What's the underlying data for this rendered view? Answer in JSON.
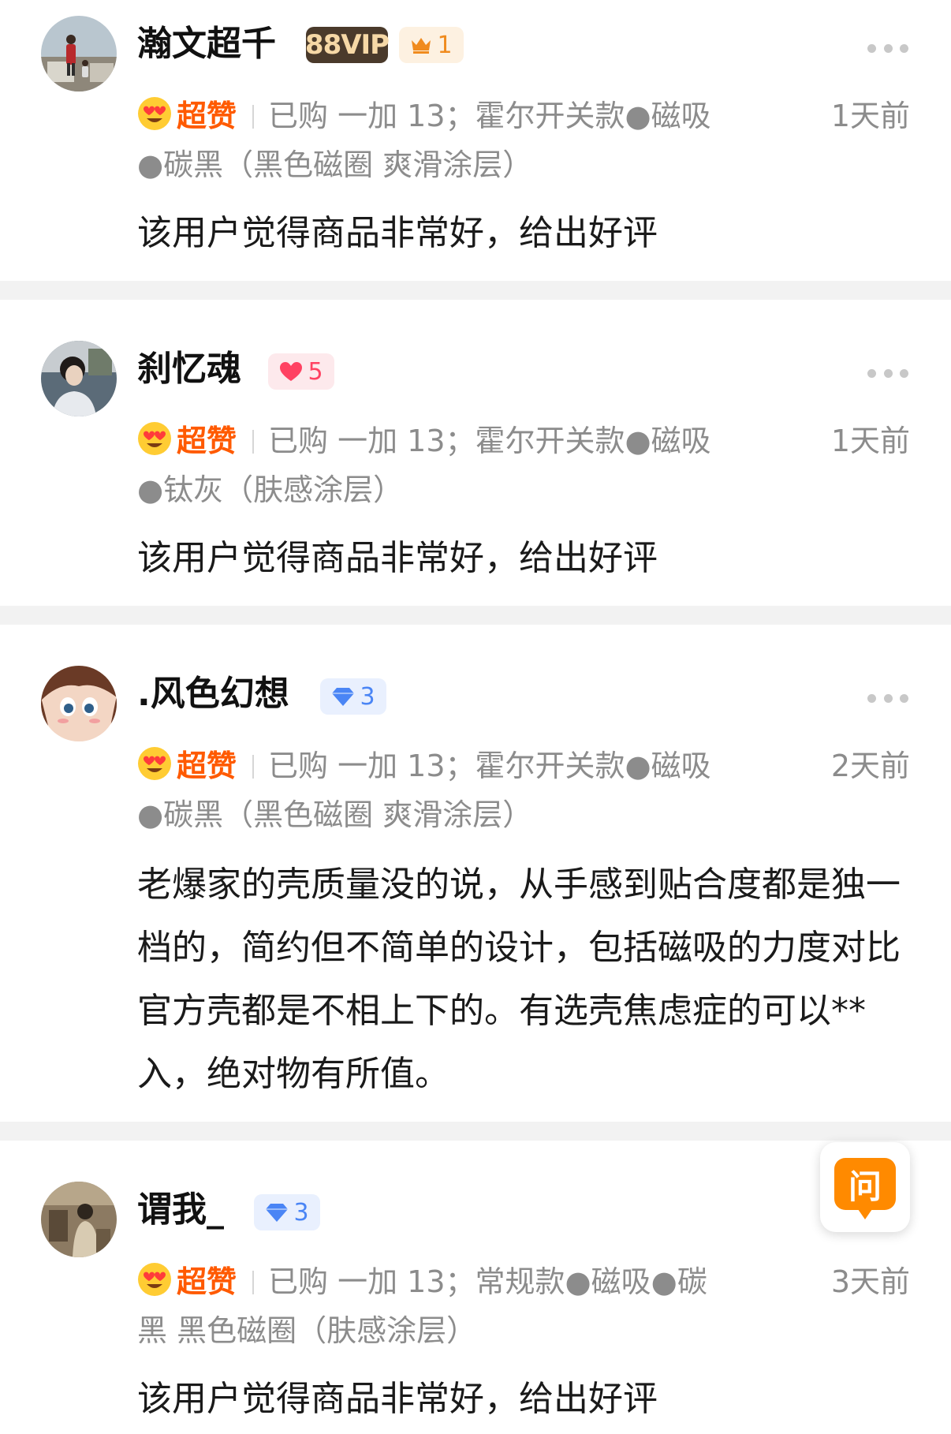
{
  "reviews": [
    {
      "username": "瀚文超千",
      "badges": [
        {
          "type": "vip",
          "label": "88VIP"
        },
        {
          "type": "crown",
          "icon": "crown-icon",
          "count": "1"
        }
      ],
      "rating_label": "超赞",
      "purchase_info": "已购 一加 13；霍尔开关款●磁吸●碳黑（黑色磁圈 爽滑涂层）",
      "time": "1天前",
      "content": "该用户觉得商品非常好，给出好评"
    },
    {
      "username": "刹忆魂",
      "badges": [
        {
          "type": "heart",
          "icon": "heart-icon",
          "count": "5"
        }
      ],
      "rating_label": "超赞",
      "purchase_info": "已购 一加 13；霍尔开关款●磁吸●钛灰（肤感涂层）",
      "time": "1天前",
      "content": "该用户觉得商品非常好，给出好评"
    },
    {
      "username": ".风色幻想",
      "badges": [
        {
          "type": "diamond",
          "icon": "diamond-icon",
          "count": "3"
        }
      ],
      "rating_label": "超赞",
      "purchase_info": "已购 一加 13；霍尔开关款●磁吸●碳黑（黑色磁圈 爽滑涂层）",
      "time": "2天前",
      "content": "老爆家的壳质量没的说，从手感到贴合度都是独一档的，简约但不简单的设计，包括磁吸的力度对比官方壳都是不相上下的。有选壳焦虑症的可以**入，绝对物有所值。"
    },
    {
      "username": "谓我_",
      "badges": [
        {
          "type": "diamond",
          "icon": "diamond-icon",
          "count": "3"
        }
      ],
      "rating_label": "超赞",
      "purchase_info": "已购 一加 13；常规款●磁吸●碳黑 黑色磁圈（肤感涂层）",
      "time": "3天前",
      "content": "该用户觉得商品非常好，给出好评"
    }
  ],
  "ask_button": {
    "label": "问",
    "icon": "ask-icon"
  },
  "colors": {
    "accent": "#ff5a00",
    "ask": "#ff8a00",
    "heart": "#ff4262",
    "diamond": "#4a85f5",
    "crown": "#f08b1e"
  }
}
